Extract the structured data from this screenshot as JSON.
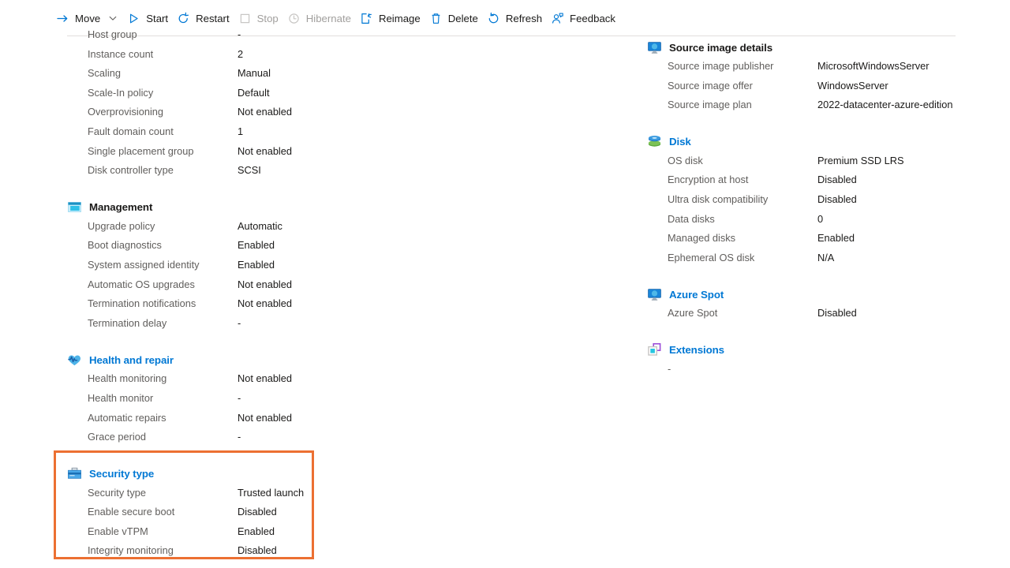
{
  "toolbar": {
    "items": [
      {
        "label": "Move",
        "icon": "move-arrow-icon",
        "disabled": false,
        "chevron": true
      },
      {
        "label": "Start",
        "icon": "play-icon",
        "disabled": false,
        "chevron": false
      },
      {
        "label": "Restart",
        "icon": "restart-icon",
        "disabled": false,
        "chevron": false
      },
      {
        "label": "Stop",
        "icon": "stop-square-icon",
        "disabled": true,
        "chevron": false
      },
      {
        "label": "Hibernate",
        "icon": "clock-icon",
        "disabled": true,
        "chevron": false
      },
      {
        "label": "Reimage",
        "icon": "reimage-icon",
        "disabled": false,
        "chevron": false
      },
      {
        "label": "Delete",
        "icon": "trash-icon",
        "disabled": false,
        "chevron": false
      },
      {
        "label": "Refresh",
        "icon": "refresh-icon",
        "disabled": false,
        "chevron": false
      },
      {
        "label": "Feedback",
        "icon": "feedback-person-icon",
        "disabled": false,
        "chevron": false
      }
    ]
  },
  "colors": {
    "accent": "#0078d4",
    "highlight_border": "#ec7032",
    "label": "#605e5c",
    "value": "#1b1a19",
    "disabled": "#a19f9d"
  },
  "left_column": {
    "top_rows": [
      {
        "key": "Host group",
        "value": "-"
      },
      {
        "key": "Instance count",
        "value": "2"
      },
      {
        "key": "Scaling",
        "value": "Manual"
      },
      {
        "key": "Scale-In policy",
        "value": "Default"
      },
      {
        "key": "Overprovisioning",
        "value": "Not enabled"
      },
      {
        "key": "Fault domain count",
        "value": "1"
      },
      {
        "key": "Single placement group",
        "value": "Not enabled"
      },
      {
        "key": "Disk controller type",
        "value": "SCSI"
      }
    ],
    "management": {
      "title": "Management",
      "icon": "window-management-icon",
      "title_color": "dark",
      "rows": [
        {
          "key": "Upgrade policy",
          "value": "Automatic"
        },
        {
          "key": "Boot diagnostics",
          "value": "Enabled"
        },
        {
          "key": "System assigned identity",
          "value": "Enabled"
        },
        {
          "key": "Automatic OS upgrades",
          "value": "Not enabled"
        },
        {
          "key": "Termination notifications",
          "value": "Not enabled"
        },
        {
          "key": "Termination delay",
          "value": "-"
        }
      ]
    },
    "health_and_repair": {
      "title": "Health and repair",
      "icon": "heart-pulse-icon",
      "title_color": "accent",
      "rows": [
        {
          "key": "Health monitoring",
          "value": "Not enabled"
        },
        {
          "key": "Health monitor",
          "value": "-"
        },
        {
          "key": "Automatic repairs",
          "value": "Not enabled"
        },
        {
          "key": "Grace period",
          "value": "-"
        }
      ]
    },
    "security_type": {
      "title": "Security type",
      "icon": "toolbox-security-icon",
      "title_color": "accent",
      "highlighted": true,
      "rows": [
        {
          "key": "Security type",
          "value": "Trusted launch"
        },
        {
          "key": "Enable secure boot",
          "value": "Disabled"
        },
        {
          "key": "Enable vTPM",
          "value": "Enabled"
        },
        {
          "key": "Integrity monitoring",
          "value": "Disabled"
        }
      ]
    }
  },
  "right_column": {
    "source_image_details": {
      "title": "Source image details",
      "icon": "monitor-icon",
      "title_color": "dark",
      "rows": [
        {
          "key": "Source image publisher",
          "value": "MicrosoftWindowsServer"
        },
        {
          "key": "Source image offer",
          "value": "WindowsServer"
        },
        {
          "key": "Source image plan",
          "value": "2022-datacenter-azure-edition"
        }
      ]
    },
    "disk": {
      "title": "Disk",
      "icon": "disk-stack-icon",
      "title_color": "accent",
      "rows": [
        {
          "key": "OS disk",
          "value": "Premium SSD LRS"
        },
        {
          "key": "Encryption at host",
          "value": "Disabled"
        },
        {
          "key": "Ultra disk compatibility",
          "value": "Disabled"
        },
        {
          "key": "Data disks",
          "value": "0"
        },
        {
          "key": "Managed disks",
          "value": "Enabled"
        },
        {
          "key": "Ephemeral OS disk",
          "value": "N/A"
        }
      ]
    },
    "azure_spot": {
      "title": "Azure Spot",
      "icon": "monitor-icon",
      "title_color": "accent",
      "rows": [
        {
          "key": "Azure Spot",
          "value": "Disabled"
        }
      ]
    },
    "extensions": {
      "title": "Extensions",
      "icon": "extensions-squares-icon",
      "title_color": "accent",
      "rows": [
        {
          "key": "-",
          "value": ""
        }
      ]
    }
  }
}
